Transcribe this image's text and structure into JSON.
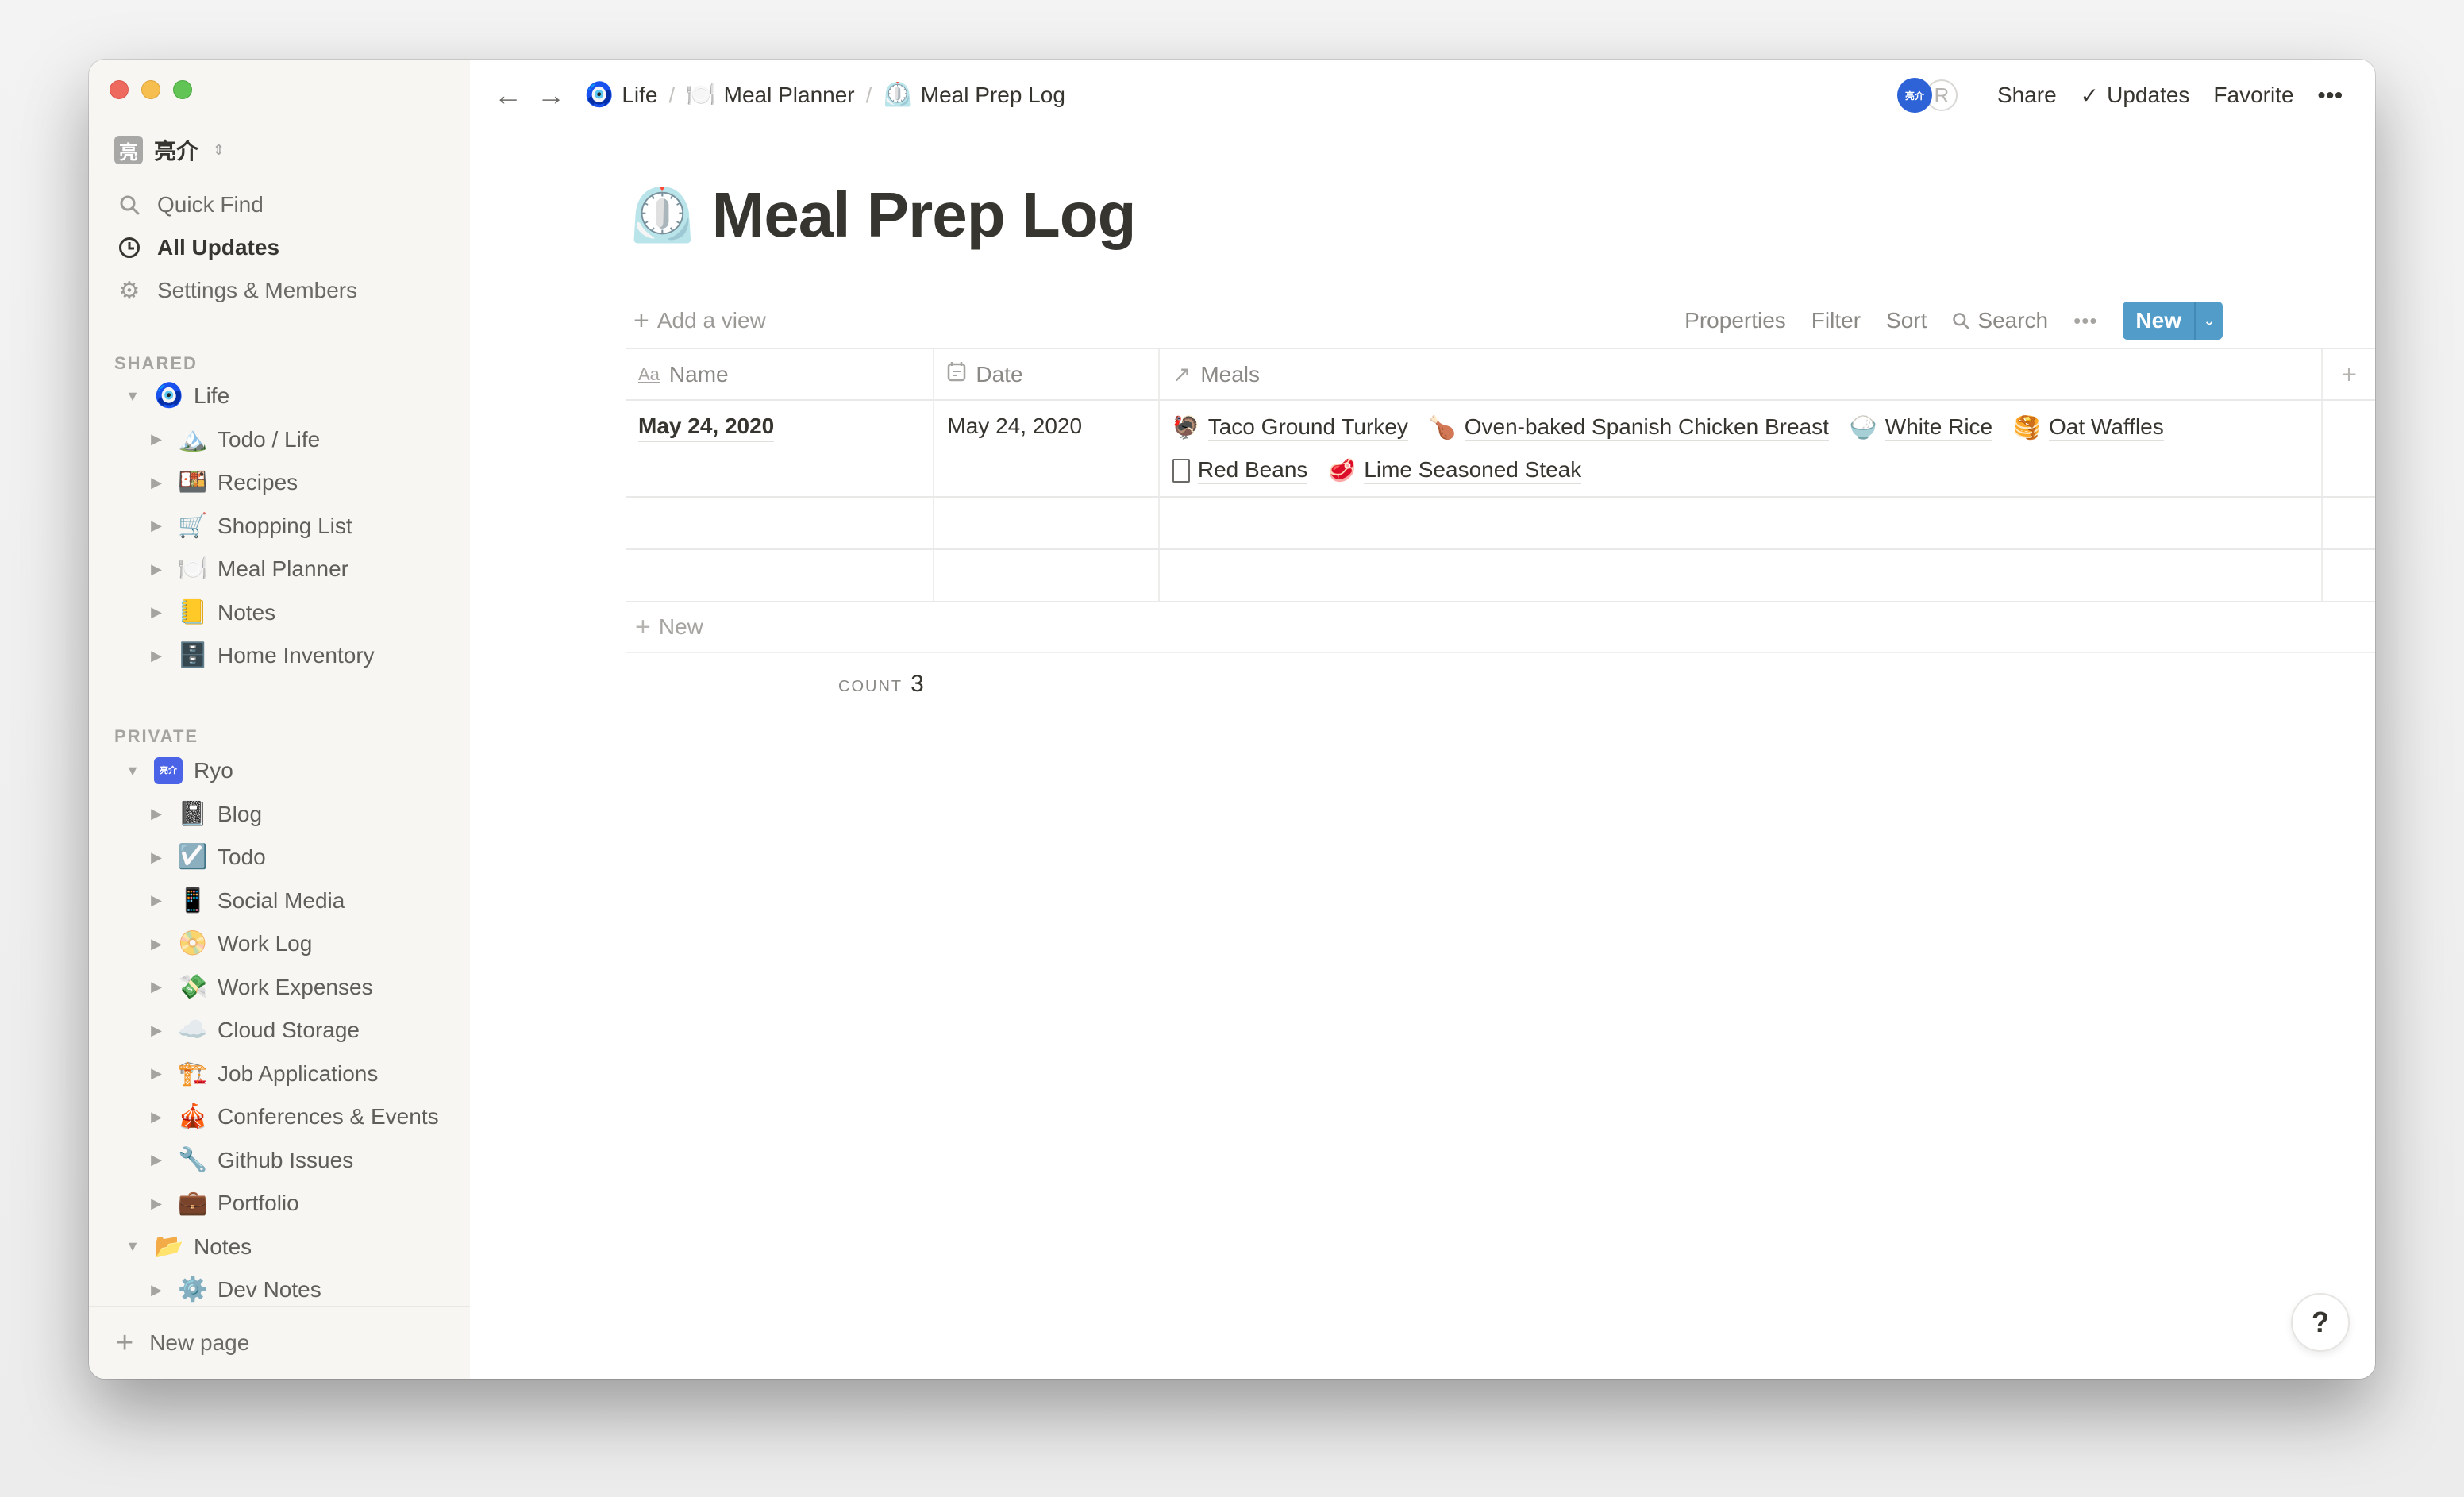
{
  "workspace": {
    "avatar_char": "亮",
    "name": "亮介"
  },
  "sidebar": {
    "nav": [
      {
        "label": "Quick Find",
        "icon": "search-icon",
        "active": false
      },
      {
        "label": "All Updates",
        "icon": "clock-icon",
        "active": true
      },
      {
        "label": "Settings & Members",
        "icon": "gear-icon",
        "active": false
      }
    ],
    "shared_label": "SHARED",
    "shared": {
      "root": {
        "label": "Life",
        "emoji": "🧿",
        "expanded": true
      },
      "children": [
        {
          "label": "Todo / Life",
          "emoji": "🏔️"
        },
        {
          "label": "Recipes",
          "emoji": "🍱"
        },
        {
          "label": "Shopping List",
          "emoji": "🛒"
        },
        {
          "label": "Meal Planner",
          "emoji": "🍽️"
        },
        {
          "label": "Notes",
          "emoji": "📒"
        },
        {
          "label": "Home Inventory",
          "emoji": "🗄️"
        }
      ]
    },
    "private_label": "PRIVATE",
    "private": {
      "root": {
        "label": "Ryo",
        "badge": "亮介",
        "expanded": true
      },
      "children": [
        {
          "label": "Blog",
          "emoji": "📓"
        },
        {
          "label": "Todo",
          "emoji": "☑️"
        },
        {
          "label": "Social Media",
          "emoji": "📱"
        },
        {
          "label": "Work Log",
          "emoji": "📀"
        },
        {
          "label": "Work Expenses",
          "emoji": "💸"
        },
        {
          "label": "Cloud Storage",
          "emoji": "☁️"
        },
        {
          "label": "Job Applications",
          "emoji": "🏗️"
        },
        {
          "label": "Conferences & Events",
          "emoji": "🎪"
        },
        {
          "label": "Github Issues",
          "emoji": "🔧"
        },
        {
          "label": "Portfolio",
          "emoji": "💼"
        }
      ],
      "notes": {
        "label": "Notes",
        "emoji": "📂",
        "expanded": true
      },
      "notes_children": [
        {
          "label": "Dev Notes",
          "emoji": "⚙️"
        }
      ]
    },
    "new_page_label": "New page"
  },
  "topbar": {
    "breadcrumb": [
      {
        "label": "Life",
        "emoji": "🧿"
      },
      {
        "label": "Meal Planner",
        "emoji": "🍽️"
      },
      {
        "label": "Meal Prep Log",
        "emoji": "⏲️"
      }
    ],
    "avatars": [
      {
        "text": "亮介",
        "color": "#2d63d6"
      },
      {
        "text": "R"
      }
    ],
    "share_label": "Share",
    "updates_label": "Updates",
    "favorite_label": "Favorite",
    "more_label": "•••"
  },
  "page": {
    "emoji": "⏲️",
    "title": "Meal Prep Log"
  },
  "view_bar": {
    "add_view_label": "Add a view",
    "properties_label": "Properties",
    "filter_label": "Filter",
    "sort_label": "Sort",
    "search_label": "Search",
    "more_label": "•••",
    "new_label": "New",
    "new_button_color": "#529cca"
  },
  "table": {
    "columns": [
      {
        "label": "Name",
        "icon": "text-type-icon",
        "glyph": "Aa"
      },
      {
        "label": "Date",
        "icon": "calendar-icon",
        "glyph": "▤"
      },
      {
        "label": "Meals",
        "icon": "relation-arrow-icon",
        "glyph": "↗"
      }
    ],
    "rows": [
      {
        "name": "May 24, 2020",
        "date": "May 24, 2020",
        "meals": [
          {
            "label": "Taco Ground Turkey",
            "emoji": "🦃"
          },
          {
            "label": "Oven-baked Spanish Chicken Breast",
            "emoji": "🍗"
          },
          {
            "label": "White Rice",
            "emoji": "🍚"
          },
          {
            "label": "Oat Waffles",
            "emoji": "🥞"
          },
          {
            "label": "Red Beans",
            "emoji": ""
          },
          {
            "label": "Lime Seasoned Steak",
            "emoji": "🥩"
          }
        ]
      },
      {
        "name": "",
        "date": "",
        "meals": []
      },
      {
        "name": "",
        "date": "",
        "meals": []
      }
    ],
    "new_row_label": "New",
    "count_label": "COUNT",
    "count_value": "3"
  },
  "help_label": "?"
}
